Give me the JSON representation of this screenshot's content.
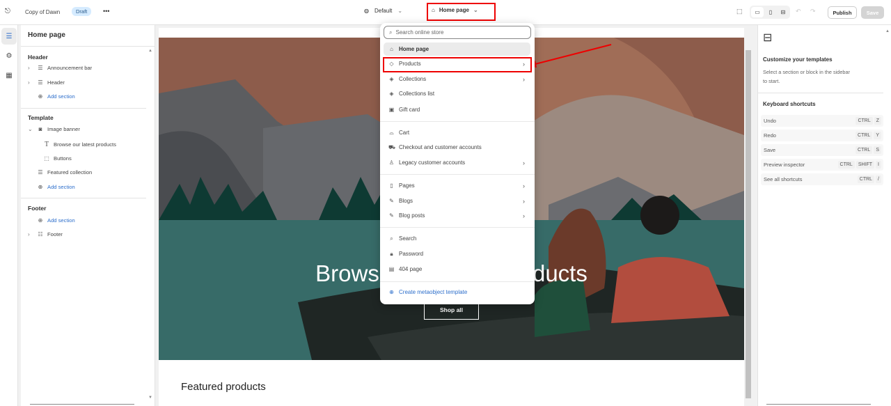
{
  "topbar": {
    "store_name": "Copy of Dawn",
    "status_badge": "Draft",
    "more": "•••",
    "theme_select": "Default",
    "page_select": "Home page",
    "publish": "Publish",
    "save": "Save"
  },
  "sidebar": {
    "title": "Home page",
    "header": {
      "label": "Header",
      "items": [
        "Announcement bar",
        "Header"
      ],
      "add": "Add section"
    },
    "template": {
      "label": "Template",
      "image_banner": "Image banner",
      "blocks": [
        "Browse our latest products",
        "Buttons"
      ],
      "featured": "Featured collection",
      "add": "Add section"
    },
    "footer": {
      "label": "Footer",
      "add": "Add section",
      "item": "Footer"
    }
  },
  "preview": {
    "hero_heading": "Browse our latest products",
    "hero_button": "Shop all",
    "featured_heading": "Featured products"
  },
  "dropdown": {
    "search_placeholder": "Search online store",
    "items": [
      "Home page",
      "Products",
      "Collections",
      "Collections list",
      "Gift card",
      "Cart",
      "Checkout and customer accounts",
      "Legacy customer accounts",
      "Pages",
      "Blogs",
      "Blog posts",
      "Search",
      "Password",
      "404 page"
    ],
    "create": "Create metaobject template"
  },
  "right_panel": {
    "title": "Customize your templates",
    "desc_line1": "Select a section or block in the sidebar",
    "desc_line2": "to start.",
    "shortcuts_title": "Keyboard shortcuts",
    "shortcuts": [
      {
        "label": "Undo",
        "keys": [
          "CTRL",
          "Z"
        ]
      },
      {
        "label": "Redo",
        "keys": [
          "CTRL",
          "Y"
        ]
      },
      {
        "label": "Save",
        "keys": [
          "CTRL",
          "S"
        ]
      },
      {
        "label": "Preview inspector",
        "keys": [
          "CTRL",
          "SHIFT",
          "I"
        ]
      },
      {
        "label": "See all shortcuts",
        "keys": [
          "CTRL",
          "/"
        ]
      }
    ]
  },
  "colors": {
    "highlight": "#e00000",
    "link": "#2c6ecb",
    "badge_bg": "#d5ebff"
  }
}
